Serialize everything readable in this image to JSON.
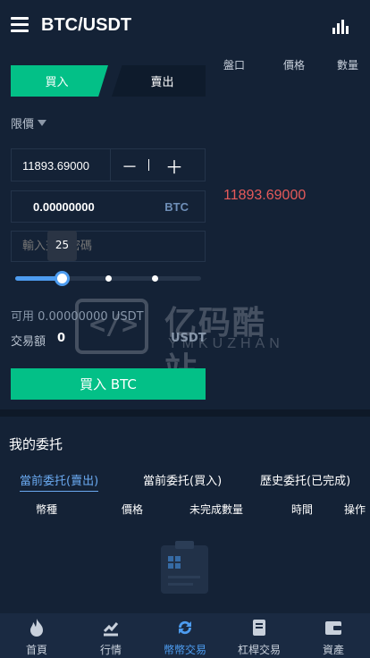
{
  "header": {
    "title": "BTC/USDT",
    "menu_icon": "hamburger-menu-icon",
    "chart_icon": "bar-chart-icon"
  },
  "trade_tabs": {
    "buy": "買入",
    "sell": "賣出"
  },
  "order_book": {
    "col_side": "盤口",
    "col_price": "價格",
    "col_amount": "數量",
    "last_price": "11893.69000"
  },
  "form": {
    "order_type": "限價",
    "price": "11893.69000",
    "minus": "－",
    "plus": "＋",
    "amount": "0.00000000",
    "amount_unit": "BTC",
    "password_placeholder": "輸入交易密碼",
    "slider_percent": 25,
    "slider_tooltip": "25",
    "available": "可用 0.00000000  USDT",
    "volume_label": "交易額",
    "volume_value": "0",
    "volume_unit": "USDT",
    "submit": "買入 BTC"
  },
  "watermark": {
    "cn": "亿码酷站",
    "en": "YMKUZHAN",
    "logo_glyph": "</>"
  },
  "orders": {
    "title": "我的委托",
    "tabs": [
      "當前委托(賣出)",
      "當前委托(買入)",
      "歷史委托(已完成)"
    ],
    "active_tab": 0,
    "columns": [
      "幣種",
      "價格",
      "未完成數量",
      "時間",
      "操作"
    ],
    "empty_icon": "clipboard-empty-icon"
  },
  "bottom_nav": [
    {
      "label": "首頁",
      "icon": "flame-icon"
    },
    {
      "label": "行情",
      "icon": "trend-icon"
    },
    {
      "label": "幣幣交易",
      "icon": "exchange-icon"
    },
    {
      "label": "杠桿交易",
      "icon": "document-icon"
    },
    {
      "label": "資產",
      "icon": "wallet-icon"
    }
  ],
  "colors": {
    "buy": "#03c087",
    "accent": "#4d9cf0",
    "price_down": "#e65a5a",
    "background": "#142236"
  }
}
